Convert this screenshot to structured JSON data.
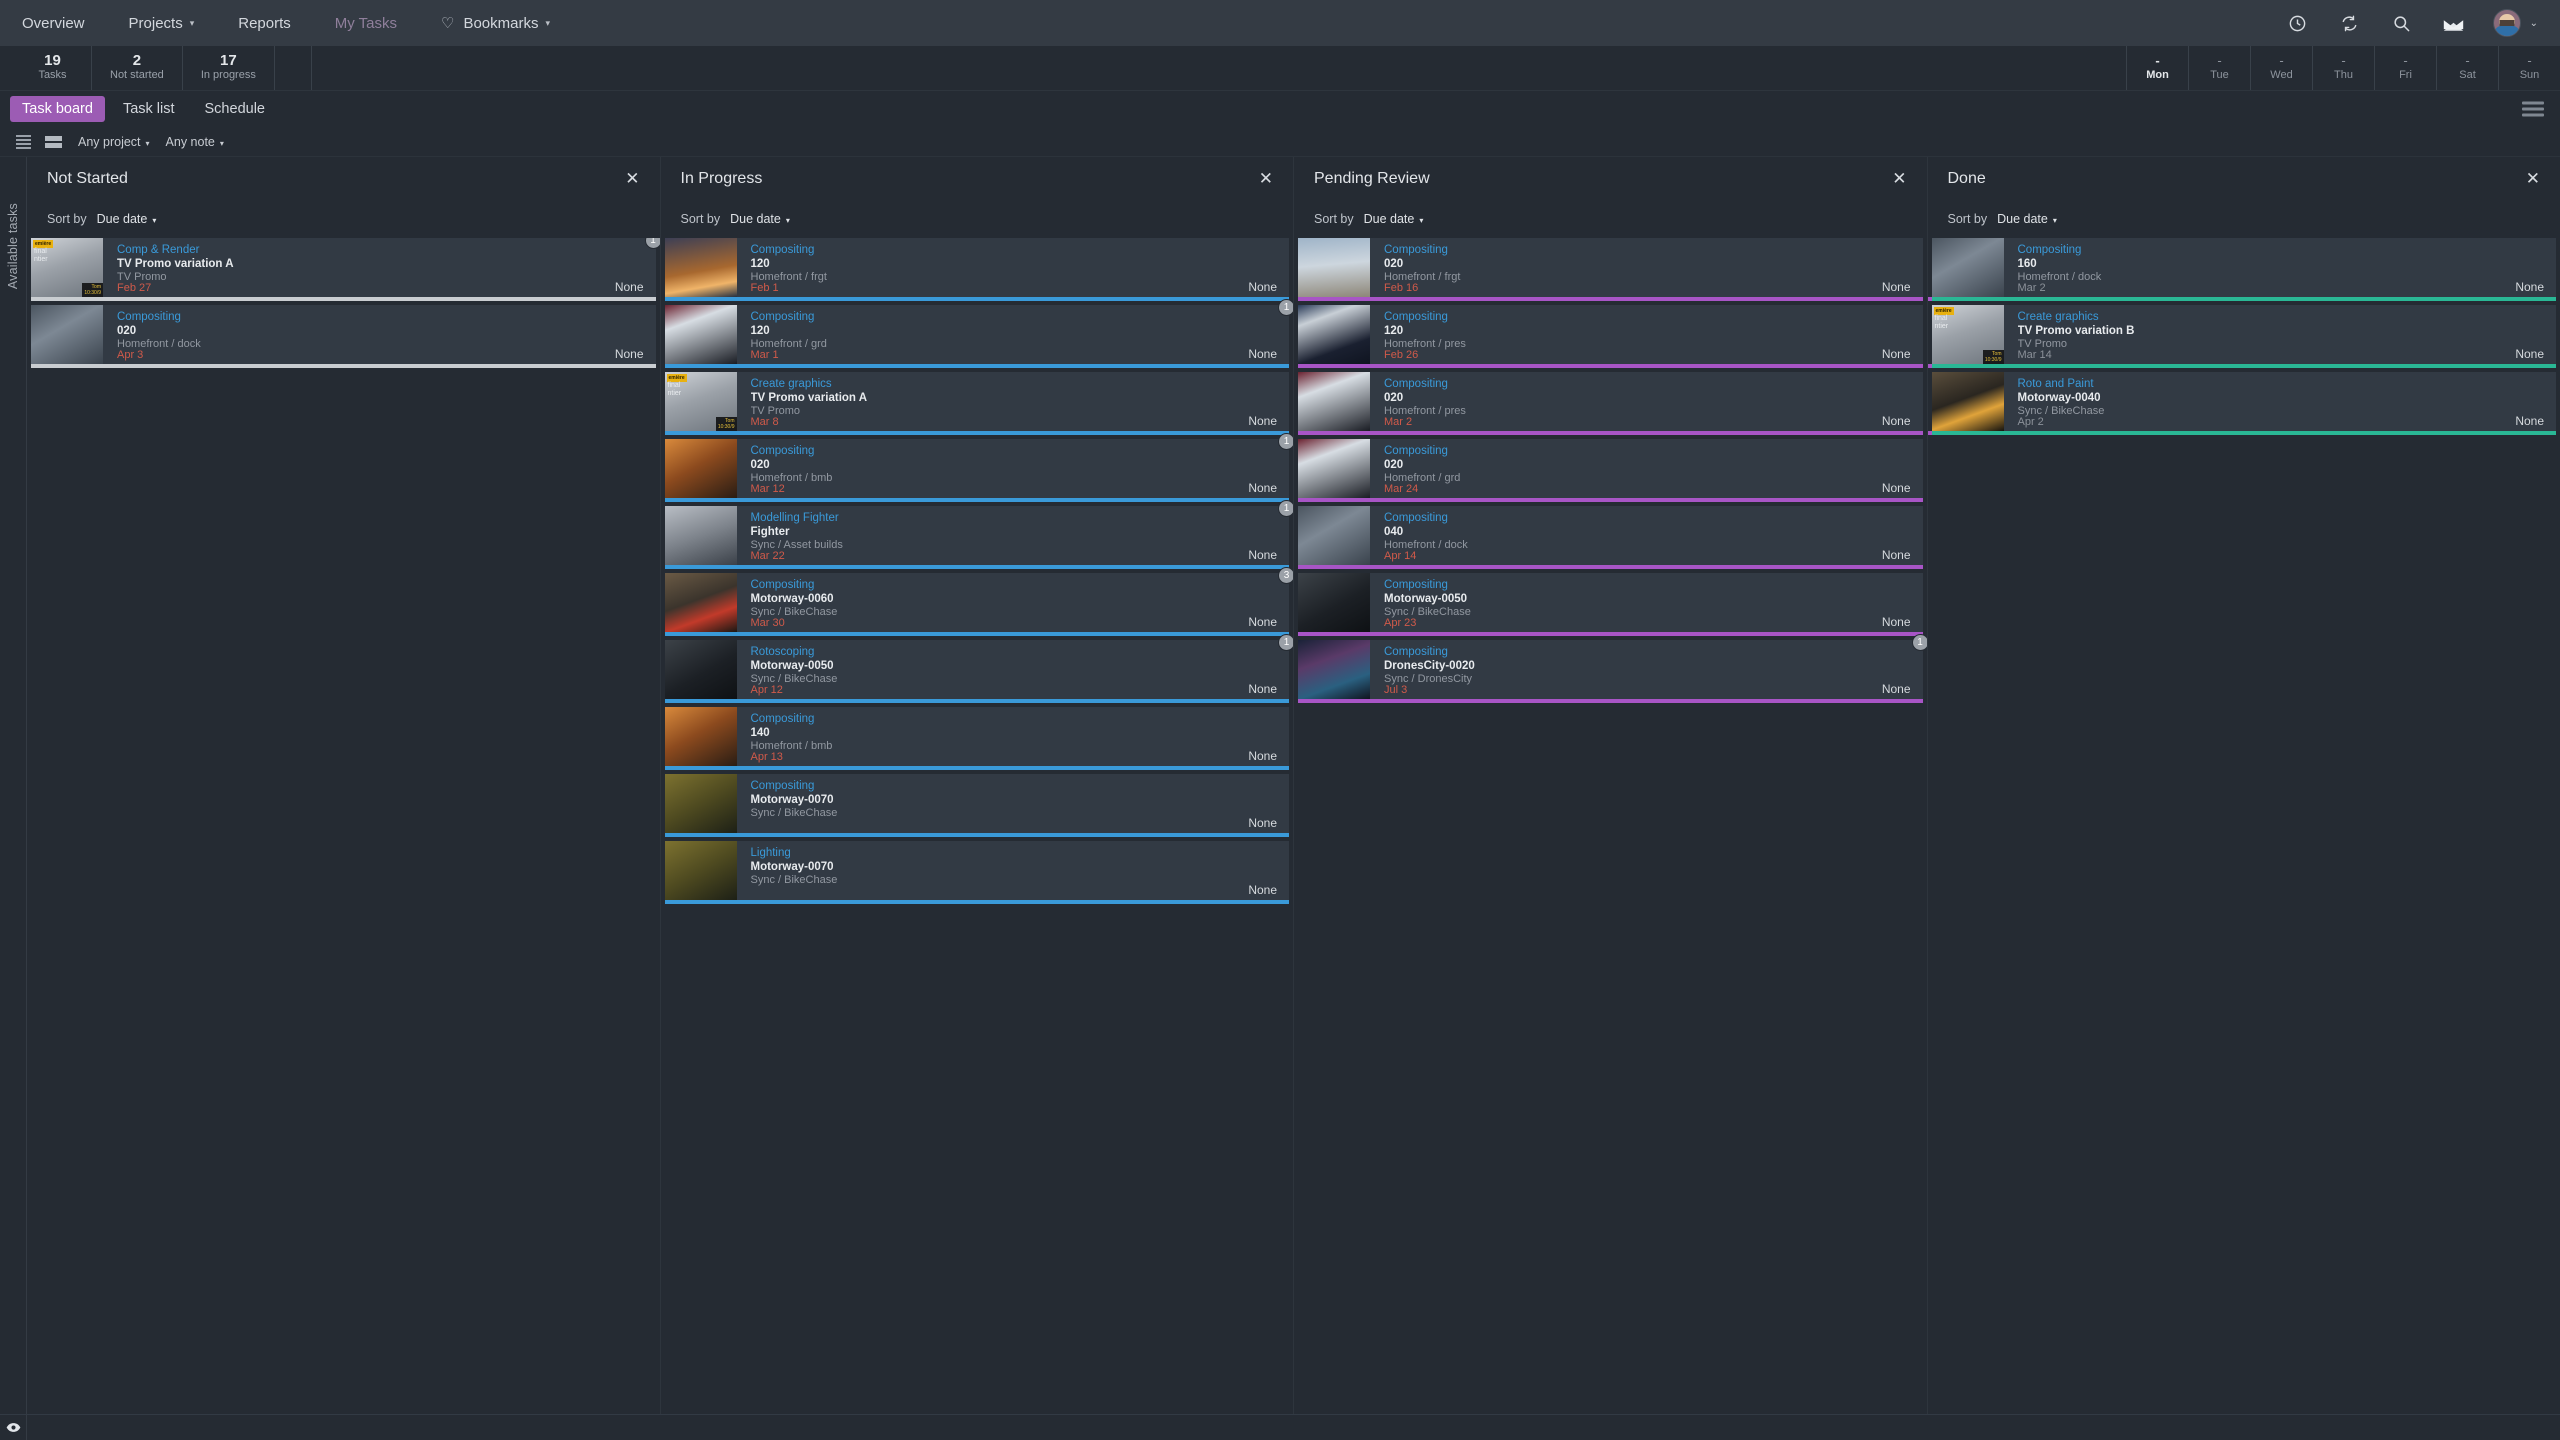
{
  "nav": {
    "items": [
      {
        "label": "Overview",
        "icon": null,
        "caret": false,
        "dim": false
      },
      {
        "label": "Projects",
        "icon": null,
        "caret": true,
        "dim": false
      },
      {
        "label": "Reports",
        "icon": null,
        "caret": false,
        "dim": false
      },
      {
        "label": "My Tasks",
        "icon": null,
        "caret": false,
        "dim": true
      },
      {
        "label": "Bookmarks",
        "icon": "heart-icon",
        "caret": true,
        "dim": false
      }
    ],
    "icons": [
      "clock-icon",
      "sync-icon",
      "search-icon",
      "inbox-icon"
    ],
    "avatar_caret": "⌄"
  },
  "stats": [
    {
      "num": "19",
      "label": "Tasks"
    },
    {
      "num": "2",
      "label": "Not started"
    },
    {
      "num": "17",
      "label": "In progress"
    }
  ],
  "week": [
    {
      "value": "-",
      "day": "Mon",
      "today": true
    },
    {
      "value": "-",
      "day": "Tue",
      "today": false
    },
    {
      "value": "-",
      "day": "Wed",
      "today": false
    },
    {
      "value": "-",
      "day": "Thu",
      "today": false
    },
    {
      "value": "-",
      "day": "Fri",
      "today": false
    },
    {
      "value": "-",
      "day": "Sat",
      "today": false
    },
    {
      "value": "-",
      "day": "Sun",
      "today": false
    }
  ],
  "tabs": [
    {
      "label": "Task board",
      "active": true
    },
    {
      "label": "Task list",
      "active": false
    },
    {
      "label": "Schedule",
      "active": false
    }
  ],
  "filters": [
    {
      "label": "Any project",
      "caret": "⌄"
    },
    {
      "label": "Any note",
      "caret": "⌄"
    }
  ],
  "rail": {
    "label": "Available tasks"
  },
  "colors": {
    "accent": "#9c5cb4",
    "link": "#3a9ad9",
    "overdue": "#d05a4a",
    "not_started_bar": "#c9cdd1",
    "in_progress_bar": "#3a9ad9",
    "pending_bar": "#a855c6",
    "done_bar": "#2ab795"
  },
  "sort": {
    "label": "Sort by",
    "value": "Due date",
    "caret": "⌄"
  },
  "close_glyph": "✕",
  "columns": [
    {
      "title": "Not Started",
      "bar_class": "bar-notstarted",
      "cards": [
        {
          "type": "Comp & Render",
          "name": "TV Promo variation A",
          "project": "TV Promo",
          "date": "Feb 27",
          "date_neutral": false,
          "assignee": "None",
          "badge": "1",
          "thumb": "promo"
        },
        {
          "type": "Compositing",
          "name": "020",
          "project": "Homefront / dock",
          "date": "Apr 3",
          "date_neutral": false,
          "assignee": "None",
          "badge": null,
          "thumb": "city-gray"
        }
      ]
    },
    {
      "title": "In Progress",
      "bar_class": "bar-inprogress",
      "cards": [
        {
          "type": "Compositing",
          "name": "120",
          "project": "Homefront / frgt",
          "date": "Feb 1",
          "date_neutral": false,
          "assignee": "None",
          "badge": null,
          "thumb": "sunset-ship"
        },
        {
          "type": "Compositing",
          "name": "120",
          "project": "Homefront / grd",
          "date": "Mar 1",
          "date_neutral": false,
          "assignee": "None",
          "badge": "1",
          "thumb": "concert"
        },
        {
          "type": "Create graphics",
          "name": "TV Promo variation A",
          "project": "TV Promo",
          "date": "Mar 8",
          "date_neutral": false,
          "assignee": "None",
          "badge": null,
          "thumb": "promo"
        },
        {
          "type": "Compositing",
          "name": "020",
          "project": "Homefront / bmb",
          "date": "Mar 12",
          "date_neutral": false,
          "assignee": "None",
          "badge": "1",
          "thumb": "explosion"
        },
        {
          "type": "Modelling Fighter",
          "name": "Fighter",
          "project": "Sync / Asset builds",
          "date": "Mar 22",
          "date_neutral": false,
          "assignee": "None",
          "badge": "1",
          "thumb": "fighter"
        },
        {
          "type": "Compositing",
          "name": "Motorway-0060",
          "project": "Sync / BikeChase",
          "date": "Mar 30",
          "date_neutral": false,
          "assignee": "None",
          "badge": "3",
          "thumb": "bike-rear"
        },
        {
          "type": "Rotoscoping",
          "name": "Motorway-0050",
          "project": "Sync / BikeChase",
          "date": "Apr 12",
          "date_neutral": false,
          "assignee": "None",
          "badge": "1",
          "thumb": "rider-dark"
        },
        {
          "type": "Compositing",
          "name": "140",
          "project": "Homefront / bmb",
          "date": "Apr 13",
          "date_neutral": false,
          "assignee": "None",
          "badge": null,
          "thumb": "explosion"
        },
        {
          "type": "Compositing",
          "name": "Motorway-0070",
          "project": "Sync / BikeChase",
          "date": "",
          "date_neutral": false,
          "assignee": "None",
          "badge": null,
          "thumb": "helmet"
        },
        {
          "type": "Lighting",
          "name": "Motorway-0070",
          "project": "Sync / BikeChase",
          "date": "",
          "date_neutral": false,
          "assignee": "None",
          "badge": null,
          "thumb": "helmet"
        }
      ]
    },
    {
      "title": "Pending Review",
      "bar_class": "bar-pending",
      "cards": [
        {
          "type": "Compositing",
          "name": "020",
          "project": "Homefront / frgt",
          "date": "Feb 16",
          "date_neutral": false,
          "assignee": "None",
          "badge": null,
          "thumb": "heli"
        },
        {
          "type": "Compositing",
          "name": "120",
          "project": "Homefront / pres",
          "date": "Feb 26",
          "date_neutral": false,
          "assignee": "None",
          "badge": null,
          "thumb": "timessquare"
        },
        {
          "type": "Compositing",
          "name": "020",
          "project": "Homefront / pres",
          "date": "Mar 2",
          "date_neutral": false,
          "assignee": "None",
          "badge": null,
          "thumb": "concert"
        },
        {
          "type": "Compositing",
          "name": "020",
          "project": "Homefront / grd",
          "date": "Mar 24",
          "date_neutral": false,
          "assignee": "None",
          "badge": null,
          "thumb": "concert"
        },
        {
          "type": "Compositing",
          "name": "040",
          "project": "Homefront / dock",
          "date": "Apr 14",
          "date_neutral": false,
          "assignee": "None",
          "badge": null,
          "thumb": "city-gray"
        },
        {
          "type": "Compositing",
          "name": "Motorway-0050",
          "project": "Sync / BikeChase",
          "date": "Apr 23",
          "date_neutral": false,
          "assignee": "None",
          "badge": null,
          "thumb": "rider-dark"
        },
        {
          "type": "Compositing",
          "name": "DronesCity-0020",
          "project": "Sync / DronesCity",
          "date": "Jul 3",
          "date_neutral": false,
          "assignee": "None",
          "badge": "1",
          "thumb": "drone-city"
        }
      ]
    },
    {
      "title": "Done",
      "bar_class": "bar-done",
      "cards": [
        {
          "type": "Compositing",
          "name": "160",
          "project": "Homefront / dock",
          "date": "Mar 2",
          "date_neutral": true,
          "assignee": "None",
          "badge": null,
          "thumb": "city-gray",
          "nub": true
        },
        {
          "type": "Create graphics",
          "name": "TV Promo variation B",
          "project": "TV Promo",
          "date": "Mar 14",
          "date_neutral": true,
          "assignee": "None",
          "badge": null,
          "thumb": "promo",
          "nub": true
        },
        {
          "type": "Roto and Paint",
          "name": "Motorway-0040",
          "project": "Sync / BikeChase",
          "date": "Apr 2",
          "date_neutral": true,
          "assignee": "None",
          "badge": null,
          "thumb": "bike-lit",
          "nub": true
        }
      ]
    }
  ],
  "footer": {
    "eye_icon": "eye-icon"
  }
}
